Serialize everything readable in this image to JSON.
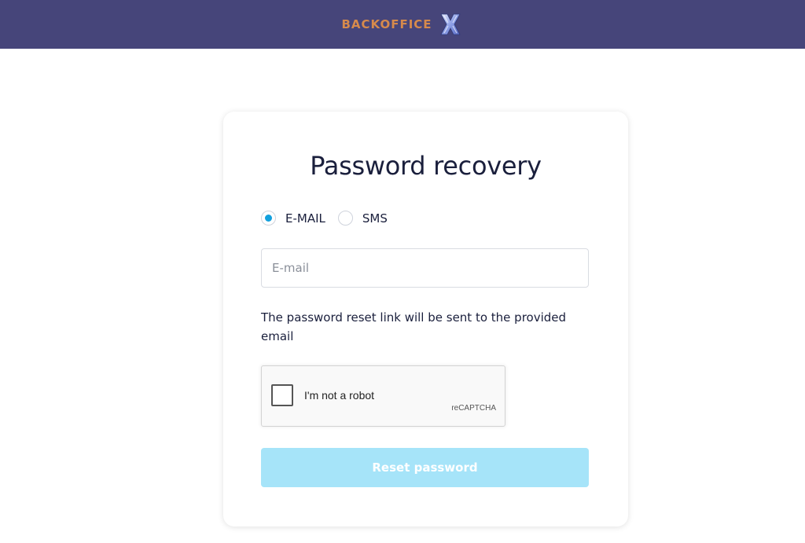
{
  "header": {
    "logo_text": "BackOffice",
    "logo_icon": "backoffice-x-logo",
    "background_color": "#46457a",
    "logo_text_color": "#d68a4c"
  },
  "form": {
    "title": "Password recovery",
    "method_options": [
      {
        "label": "E-MAIL",
        "selected": true
      },
      {
        "label": "SMS",
        "selected": false
      }
    ],
    "email_placeholder": "E-mail",
    "email_value": "",
    "hint": "The password reset link will be sent to the provided email",
    "captcha": {
      "label": "I'm not a robot",
      "brand": "reCAPTCHA",
      "checked": false
    },
    "submit_label": "Reset password",
    "accent_color": "#12a0dd",
    "submit_color": "#a6e4f9"
  }
}
